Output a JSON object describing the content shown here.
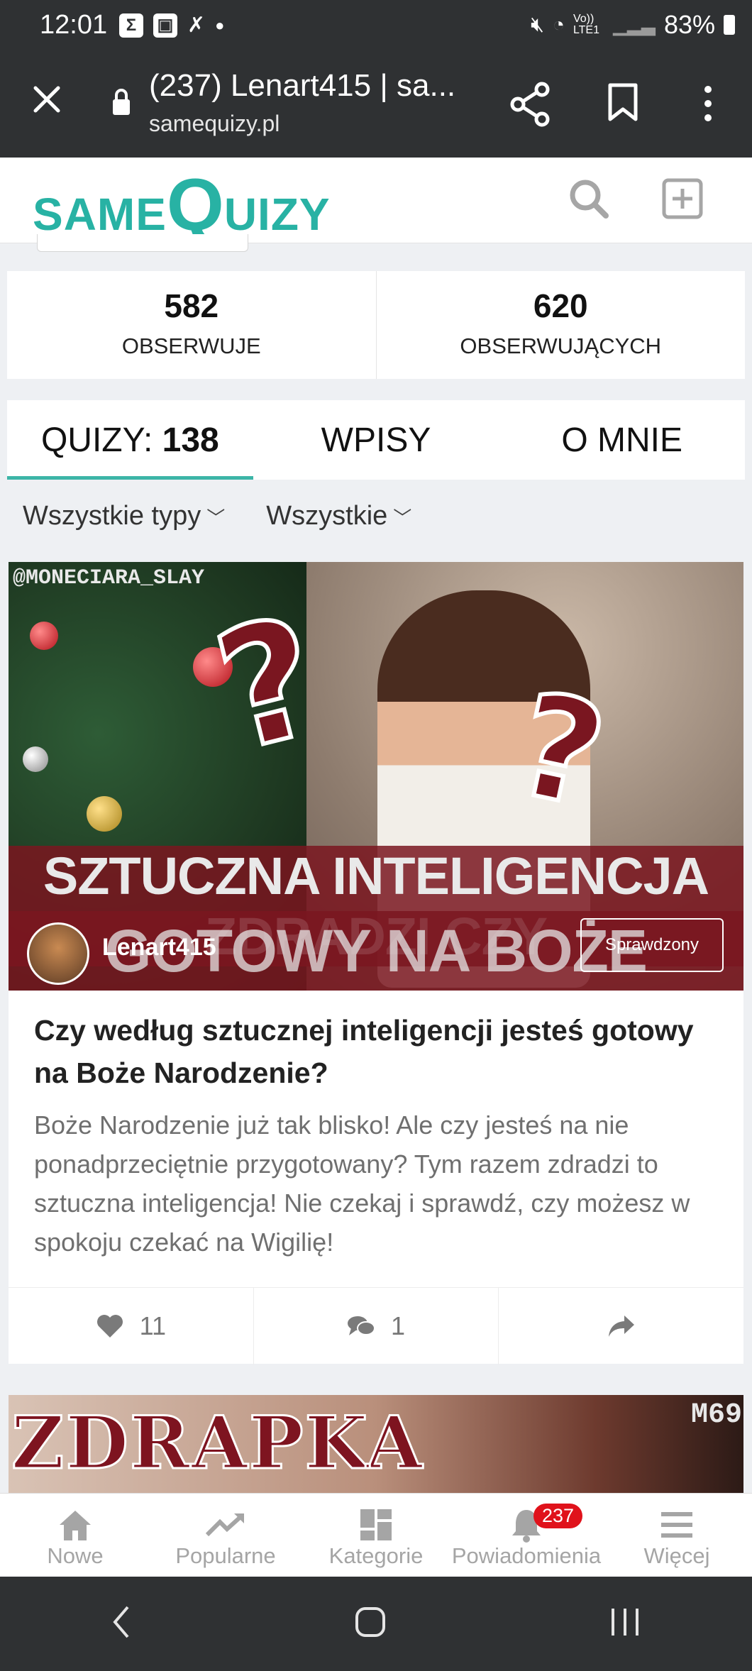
{
  "status_bar": {
    "time": "12:01",
    "battery": "83%",
    "network": "Vo)) LTE1"
  },
  "browser": {
    "tab_title": "(237) Lenart415 | sa...",
    "domain": "samequizy.pl"
  },
  "site": {
    "logo_text": "SAMEQUIZY"
  },
  "profile_stats": [
    {
      "value": "582",
      "label": "OBSERWUJE"
    },
    {
      "value": "620",
      "label": "OBSERWUJĄCYCH"
    }
  ],
  "tabs": {
    "quizy_label": "QUIZY: ",
    "quizy_count": "138",
    "wpisy": "WPISY",
    "o_mnie": "O MNIE"
  },
  "filters": {
    "types": "Wszystkie typy",
    "all": "Wszystkie"
  },
  "quiz_card": {
    "watermark": "@MONECIARA_SLAY",
    "banner_line1": "SZTUCZNA INTELIGENCJA ZDRADZI CZY",
    "banner_line2": "GOTOWY NA BOŻE NARODZENIE",
    "author": "Lenart415",
    "badge": "Sprawdzony",
    "title": "Czy według sztucznej inteligencji jesteś gotowy na Boże Narodzenie?",
    "description": "Boże Narodzenie już tak blisko! Ale czy jesteś na nie ponadprzeciętnie przygotowany? Tym razem zdradzi to sztuczna inteligencja! Nie czekaj i sprawdź, czy możesz w spokoju czekać na Wigilię!",
    "likes": "11",
    "comments": "1"
  },
  "next_card": {
    "title": "ZDRAPKA",
    "mark": "M69"
  },
  "bottom_nav": [
    {
      "label": "Nowe",
      "icon": "home-icon"
    },
    {
      "label": "Popularne",
      "icon": "trending-icon"
    },
    {
      "label": "Kategorie",
      "icon": "grid-icon"
    },
    {
      "label": "Powiadomienia",
      "icon": "bell-icon",
      "badge": "237"
    },
    {
      "label": "Więcej",
      "icon": "menu-icon"
    }
  ],
  "colors": {
    "brand": "#28b2a4",
    "dark_bar": "#2f3133",
    "badge_red": "#e0121b",
    "quiz_maroon": "#7a1620"
  }
}
